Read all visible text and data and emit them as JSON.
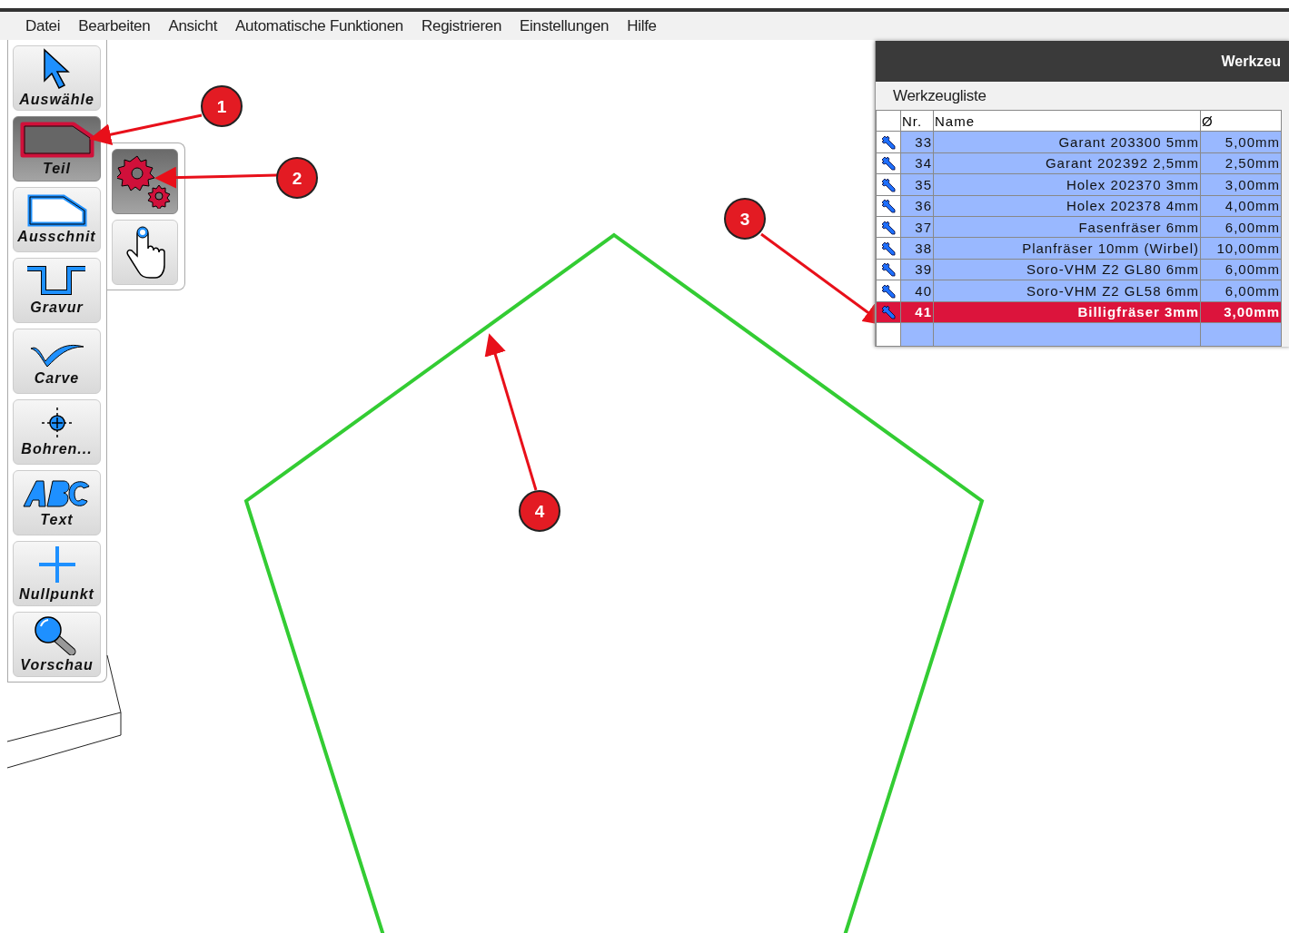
{
  "menu": [
    "Datei",
    "Bearbeiten",
    "Ansicht",
    "Automatische Funktionen",
    "Registrieren",
    "Einstellungen",
    "Hilfe"
  ],
  "tools": [
    {
      "kind": "pointer",
      "label": "Auswähle",
      "selected": false
    },
    {
      "kind": "part",
      "label": "Teil",
      "selected": true
    },
    {
      "kind": "cutout",
      "label": "Ausschnit",
      "selected": false
    },
    {
      "kind": "engrave",
      "label": "Gravur",
      "selected": false
    },
    {
      "kind": "carve",
      "label": "Carve",
      "selected": false
    },
    {
      "kind": "drill",
      "label": "Bohren...",
      "selected": false
    },
    {
      "kind": "text",
      "label": "Text",
      "selected": false
    },
    {
      "kind": "origin",
      "label": "Nullpunkt",
      "selected": false
    },
    {
      "kind": "preview",
      "label": "Vorschau",
      "selected": false
    }
  ],
  "subtools": [
    {
      "kind": "gears",
      "selected": true
    },
    {
      "kind": "hand",
      "selected": false
    }
  ],
  "callouts": [
    "1",
    "2",
    "3",
    "4"
  ],
  "tool_window": {
    "title": "Werkzeu",
    "panel_title": "Werkzeugliste",
    "columns": [
      "Nr.",
      "Name",
      "Ø"
    ],
    "rows": [
      {
        "nr": "33",
        "name": "Garant 203300 5mm",
        "diameter": "5,00mm",
        "selected": false
      },
      {
        "nr": "34",
        "name": "Garant 202392 2,5mm",
        "diameter": "2,50mm",
        "selected": false
      },
      {
        "nr": "35",
        "name": "Holex 202370 3mm",
        "diameter": "3,00mm",
        "selected": false
      },
      {
        "nr": "36",
        "name": "Holex 202378 4mm",
        "diameter": "4,00mm",
        "selected": false
      },
      {
        "nr": "37",
        "name": "Fasenfräser 6mm",
        "diameter": "6,00mm",
        "selected": false
      },
      {
        "nr": "38",
        "name": "Planfräser 10mm (Wirbel)",
        "diameter": "10,00mm",
        "selected": false
      },
      {
        "nr": "39",
        "name": "Soro-VHM Z2 GL80 6mm",
        "diameter": "6,00mm",
        "selected": false
      },
      {
        "nr": "40",
        "name": "Soro-VHM Z2 GL58 6mm",
        "diameter": "6,00mm",
        "selected": false
      },
      {
        "nr": "41",
        "name": "Billigfräser 3mm",
        "diameter": "3,00mm",
        "selected": true
      }
    ]
  }
}
